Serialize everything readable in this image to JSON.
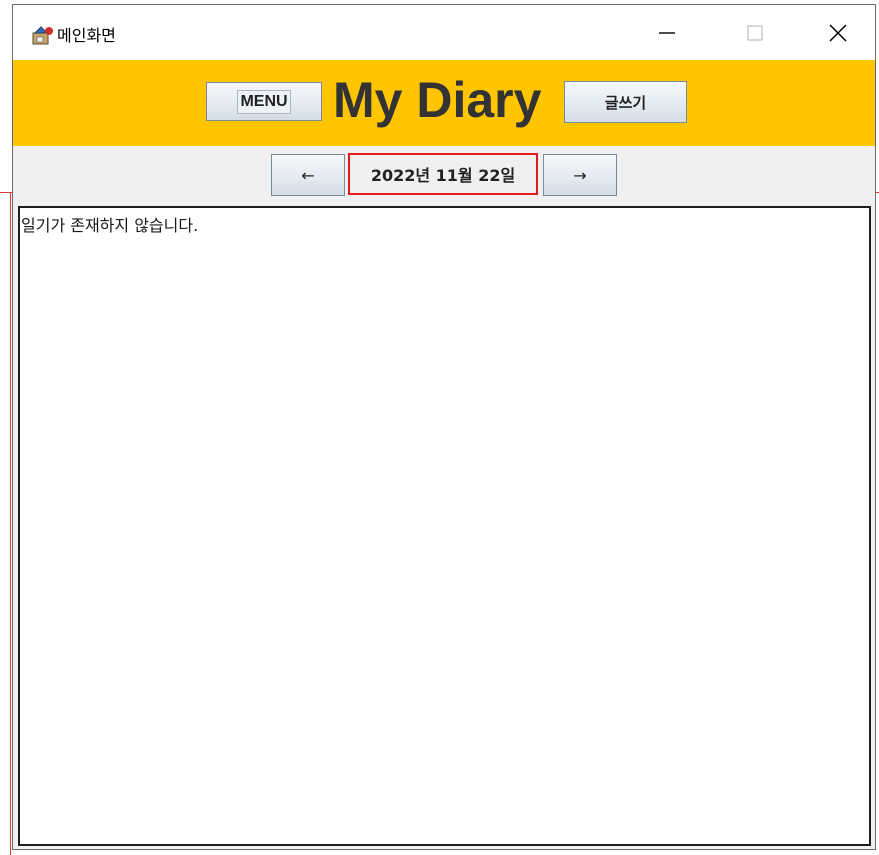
{
  "window": {
    "title": "메인화면",
    "icon": "java-app-icon",
    "controls": {
      "minimize_icon": "minimize-icon",
      "maximize_icon": "maximize-icon",
      "close_icon": "close-icon"
    }
  },
  "header": {
    "background_color": "#ffc600",
    "menu_button_label": "MENU",
    "brand_title": "My Diary",
    "write_button_label": "글쓰기"
  },
  "date_nav": {
    "prev_label": "←",
    "date_text": "2022년 11월 22일",
    "next_label": "→",
    "highlight_color": "#e01919"
  },
  "content": {
    "message": "일기가 존재하지 않습니다."
  }
}
